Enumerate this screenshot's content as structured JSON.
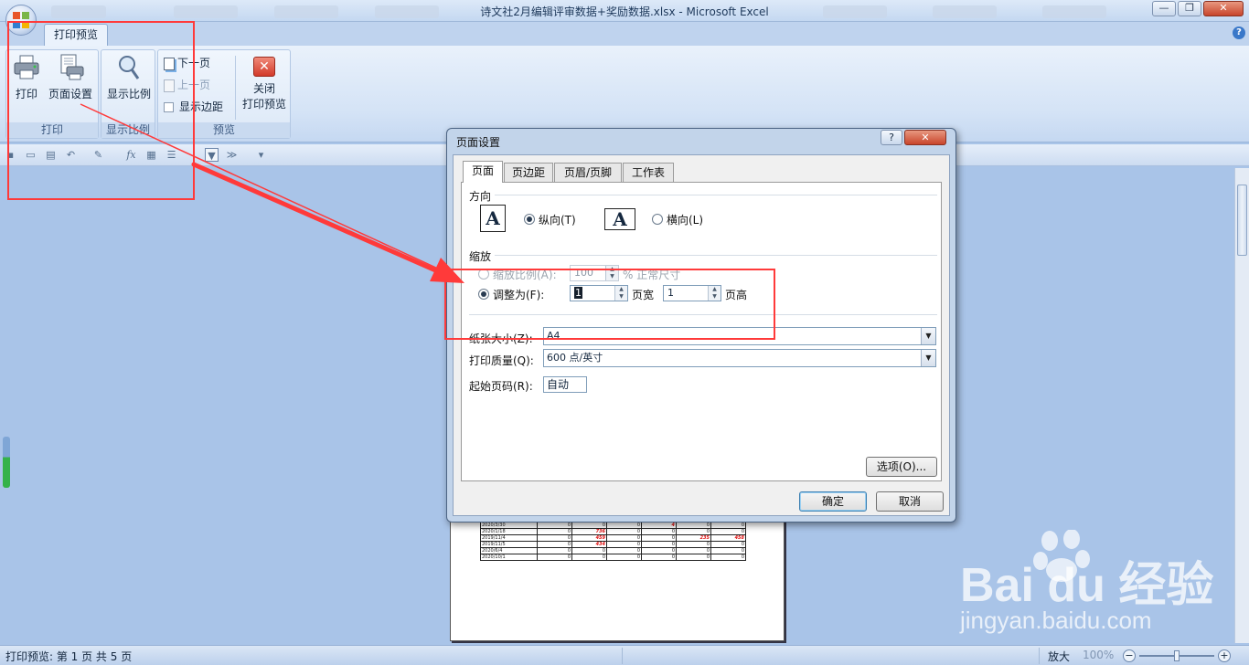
{
  "window": {
    "title": "诗文社2月编辑评审数据+奖励数据.xlsx - Microsoft Excel",
    "min_label": "—",
    "max_label": "❐",
    "close_label": "✕"
  },
  "ribbon": {
    "tab_label": "打印预览",
    "help_label": "?",
    "groups": {
      "print": {
        "label": "打印",
        "print_button": "打印",
        "page_setup_button": "页面设置"
      },
      "zoom": {
        "label": "显示比例",
        "zoom_button": "显示比例"
      },
      "preview": {
        "label": "预览",
        "next_page": "下一页",
        "prev_page": "上一页",
        "show_margins": "显示边距",
        "close_preview_line1": "关闭",
        "close_preview_line2": "打印预览"
      }
    }
  },
  "dialog": {
    "title": "页面设置",
    "help_label": "?",
    "close_label": "✕",
    "tabs": [
      "页面",
      "页边距",
      "页眉/页脚",
      "工作表"
    ],
    "active_tab": 0,
    "orientation": {
      "section_label": "方向",
      "portrait_label": "纵向(T)",
      "landscape_label": "横向(L)",
      "selected": "portrait",
      "icon_glyph": "A"
    },
    "scaling": {
      "section_label": "缩放",
      "adjust_label": "缩放比例(A):",
      "adjust_value": "100",
      "adjust_suffix": "% 正常尺寸",
      "fit_label": "调整为(F):",
      "fit_wide_value": "1",
      "fit_wide_suffix": "页宽",
      "fit_tall_value": "1",
      "fit_tall_suffix": "页高",
      "selected": "fit"
    },
    "paper_size": {
      "label": "纸张大小(Z):",
      "value": "A4"
    },
    "print_quality": {
      "label": "打印质量(Q):",
      "value": "600 点/英寸"
    },
    "first_page": {
      "label": "起始页码(R):",
      "value": "自动"
    },
    "options_button": "选项(O)...",
    "ok_button": "确定",
    "cancel_button": "取消"
  },
  "preview_table": {
    "rows": [
      [
        "2020/3/30",
        "0",
        "0",
        "0",
        "4",
        "0",
        "0"
      ],
      [
        "2020/1/18",
        "0",
        "736",
        "0",
        "0",
        "0",
        "0"
      ],
      [
        "2019/11/4",
        "0",
        "459",
        "0",
        "0",
        "235",
        "458"
      ],
      [
        "2019/11/5",
        "0",
        "434",
        "0",
        "0",
        "0",
        "0"
      ],
      [
        "2020/6/4",
        "0",
        "0",
        "0",
        "0",
        "0",
        "0"
      ],
      [
        "2020/10/1",
        "0",
        "0",
        "0",
        "0",
        "0",
        "0"
      ]
    ],
    "red_cells": [
      [
        0,
        4
      ],
      [
        1,
        2
      ],
      [
        2,
        2
      ],
      [
        2,
        5
      ],
      [
        2,
        6
      ],
      [
        3,
        2
      ]
    ]
  },
  "statusbar": {
    "text": "打印预览: 第 1 页  共 5 页",
    "zoom_label": "放大",
    "zoom_value": "100%"
  },
  "watermark": {
    "text": "Bai du 经验",
    "url": "jingyan.baidu.com"
  },
  "colors": {
    "annotation": "#ff3a3a",
    "ribbon": "#d4e3f6",
    "workspace": "#a9c4e8"
  }
}
